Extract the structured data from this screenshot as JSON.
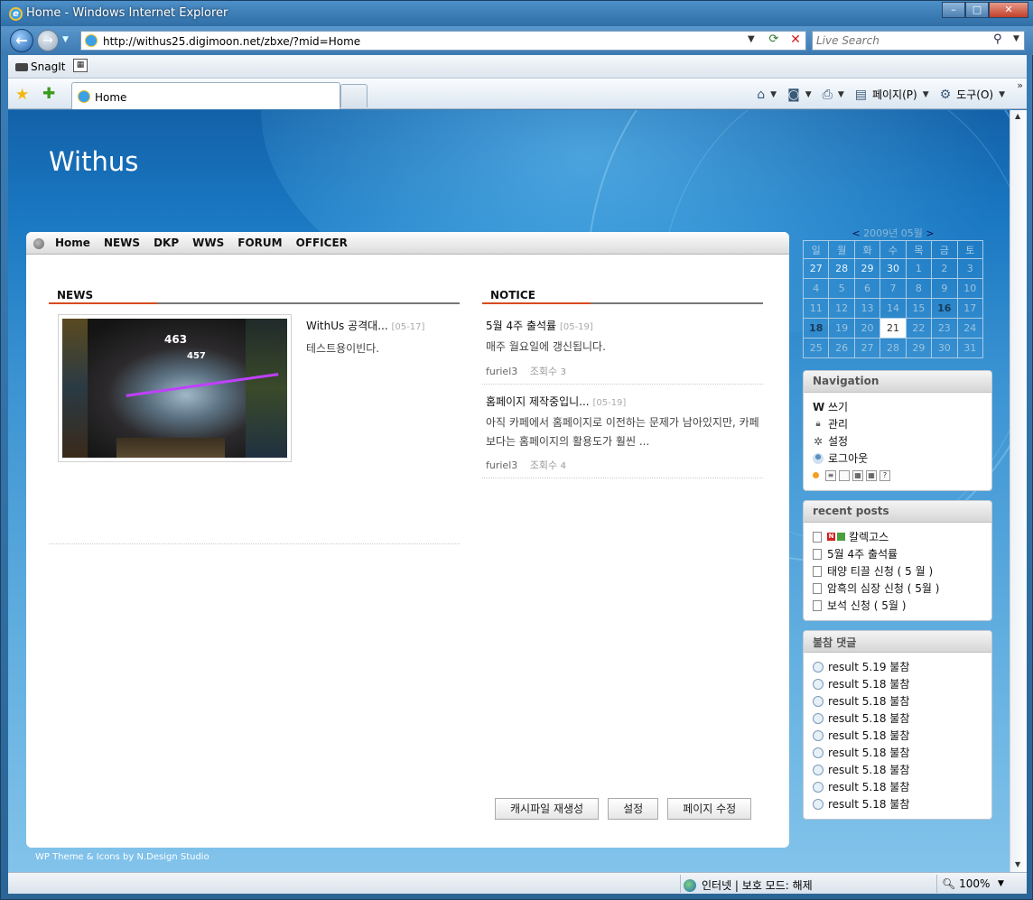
{
  "window": {
    "title": "Home - Windows Internet Explorer",
    "minimize": "–",
    "maximize": "□",
    "close": "✕"
  },
  "nav": {
    "back": "←",
    "forward": "→",
    "url": "http://withus25.digimoon.net/zbxe/?mid=Home",
    "search_placeholder": "Live Search"
  },
  "linksbar": {
    "snagit": "SnagIt"
  },
  "tabs": [
    {
      "label": "Home"
    }
  ],
  "commands": {
    "page": "페이지(P)",
    "tools": "도구(O)"
  },
  "site": {
    "title": "Withus",
    "menu": [
      "Home",
      "NEWS",
      "DKP",
      "WWS",
      "FORUM",
      "OFFICER"
    ],
    "footer": "WP Theme & Icons by N.Design Studio"
  },
  "news": {
    "heading": "NEWS",
    "item": {
      "title": "WithUs 공격대...",
      "date": "[05-17]",
      "summary": "테스트용이빈다.",
      "img_num1": "463",
      "img_num2": "457"
    }
  },
  "notice": {
    "heading": "NOTICE",
    "items": [
      {
        "title": "5월 4주 출석률",
        "date": "[05-19]",
        "summary": "매주 월요일에 갱신됩니다.",
        "author": "furiel3",
        "views_label": "조회수",
        "views": "3"
      },
      {
        "title": "홈페이지 제작중입니...",
        "date": "[05-19]",
        "summary": "아직 카페에서 홈페이지로 이전하는 문제가 남아있지만, 카페보다는 홈페이지의 활용도가 훨씬 ...",
        "author": "furiel3",
        "views_label": "조회수",
        "views": "4"
      }
    ]
  },
  "buttons": {
    "cache": "캐시파일 재생성",
    "settings": "설정",
    "edit_page": "페이지 수정"
  },
  "calendar": {
    "prev": "<",
    "next": ">",
    "month_label": "2009년 05월",
    "dow": [
      "일",
      "월",
      "화",
      "수",
      "목",
      "금",
      "토"
    ],
    "weeks": [
      [
        "27",
        "28",
        "29",
        "30",
        "1",
        "2",
        "3"
      ],
      [
        "4",
        "5",
        "6",
        "7",
        "8",
        "9",
        "10"
      ],
      [
        "11",
        "12",
        "13",
        "14",
        "15",
        "16",
        "17"
      ],
      [
        "18",
        "19",
        "20",
        "21",
        "22",
        "23",
        "24"
      ],
      [
        "25",
        "26",
        "27",
        "28",
        "29",
        "30",
        "31"
      ]
    ]
  },
  "navigation_box": {
    "title": "Navigation",
    "items": [
      "쓰기",
      "관리",
      "설정",
      "로그아웃"
    ],
    "help": "?"
  },
  "recent_posts": {
    "title": "recent posts",
    "new_badge": "N",
    "items": [
      "칼렉고스",
      "5월 4주 출석률",
      "태양 티끌 신청 ( 5 월 )",
      "암흑의 심장 신청 ( 5월 )",
      "보석 신청 ( 5월 )"
    ]
  },
  "comments": {
    "title": "불참 댓글",
    "items": [
      "result 5.19 불참",
      "result 5.18 불참",
      "result 5.18 불참",
      "result 5.18 불참",
      "result 5.18 불참",
      "result 5.18 불참",
      "result 5.18 불참",
      "result 5.18 불참",
      "result 5.18 불참"
    ]
  },
  "statusbar": {
    "zone": "인터넷 | 보호 모드: 해제",
    "zoom": "100%"
  },
  "colors": {
    "accent_red": "#d94b1e",
    "page_blue": "#1a78c2"
  }
}
